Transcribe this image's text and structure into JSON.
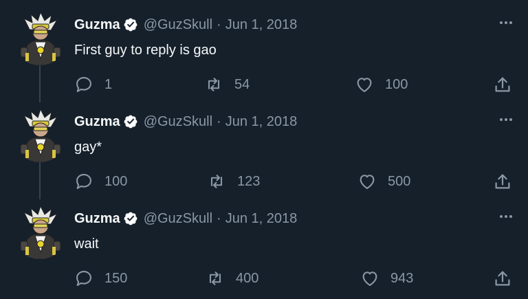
{
  "colors": {
    "background": "#15202b",
    "name_text": "#f7f9f9",
    "secondary_text": "#8b98a5",
    "verified_badge": "#ffffff",
    "thread_line": "#38444d"
  },
  "tweets": [
    {
      "name": "Guzma",
      "handle": "@GuzSkull",
      "separator": "·",
      "date": "Jun 1, 2018",
      "text": "First guy to reply is gao",
      "replies": "1",
      "retweets": "54",
      "likes": "100"
    },
    {
      "name": "Guzma",
      "handle": "@GuzSkull",
      "separator": "·",
      "date": "Jun 1, 2018",
      "text": "gay*",
      "replies": "100",
      "retweets": "123",
      "likes": "500"
    },
    {
      "name": "Guzma",
      "handle": "@GuzSkull",
      "separator": "·",
      "date": "Jun 1, 2018",
      "text": "wait",
      "replies": "150",
      "retweets": "400",
      "likes": "943"
    }
  ],
  "icons": {
    "verified": "verified-badge-icon",
    "more": "more-options-icon",
    "reply": "reply-bubble-icon",
    "retweet": "retweet-arrows-icon",
    "like": "heart-icon",
    "share": "share-upload-icon"
  }
}
